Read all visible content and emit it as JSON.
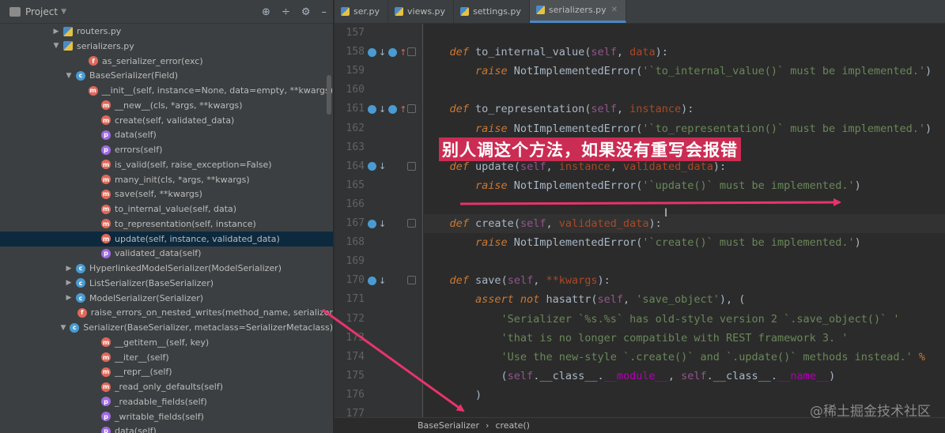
{
  "project": {
    "title": "Project",
    "tools": [
      "⊕",
      "÷",
      "⚙",
      "–"
    ],
    "tree": [
      {
        "indent": 80,
        "arrow": "▶",
        "icon": "py",
        "icon_name": "python-file-icon",
        "label": "routers.py",
        "selected": false
      },
      {
        "indent": 80,
        "arrow": "▼",
        "icon": "py",
        "icon_name": "python-file-icon",
        "label": "serializers.py",
        "selected": false
      },
      {
        "indent": 112,
        "arrow": "",
        "icon": "f",
        "icon_name": "function-icon",
        "label": "as_serializer_error(exc)",
        "selected": false
      },
      {
        "indent": 96,
        "arrow": "▼",
        "icon": "c",
        "icon_name": "class-icon",
        "label": "BaseSerializer(Field)",
        "selected": false
      },
      {
        "indent": 128,
        "arrow": "",
        "icon": "m",
        "icon_name": "method-icon",
        "label": "__init__(self, instance=None, data=empty, **kwargs)",
        "selected": false
      },
      {
        "indent": 128,
        "arrow": "",
        "icon": "m",
        "icon_name": "method-icon",
        "label": "__new__(cls, *args, **kwargs)",
        "selected": false
      },
      {
        "indent": 128,
        "arrow": "",
        "icon": "m",
        "icon_name": "method-icon",
        "label": "create(self, validated_data)",
        "selected": false
      },
      {
        "indent": 128,
        "arrow": "",
        "icon": "p",
        "icon_name": "property-icon",
        "label": "data(self)",
        "selected": false
      },
      {
        "indent": 128,
        "arrow": "",
        "icon": "p",
        "icon_name": "property-icon",
        "label": "errors(self)",
        "selected": false
      },
      {
        "indent": 128,
        "arrow": "",
        "icon": "m",
        "icon_name": "method-icon",
        "label": "is_valid(self, raise_exception=False)",
        "selected": false
      },
      {
        "indent": 128,
        "arrow": "",
        "icon": "m",
        "icon_name": "method-icon",
        "label": "many_init(cls, *args, **kwargs)",
        "selected": false
      },
      {
        "indent": 128,
        "arrow": "",
        "icon": "m",
        "icon_name": "method-icon",
        "label": "save(self, **kwargs)",
        "selected": false
      },
      {
        "indent": 128,
        "arrow": "",
        "icon": "m",
        "icon_name": "method-icon",
        "label": "to_internal_value(self, data)",
        "selected": false
      },
      {
        "indent": 128,
        "arrow": "",
        "icon": "m",
        "icon_name": "method-icon",
        "label": "to_representation(self, instance)",
        "selected": false
      },
      {
        "indent": 128,
        "arrow": "",
        "icon": "m",
        "icon_name": "method-icon",
        "label": "update(self, instance, validated_data)",
        "selected": true
      },
      {
        "indent": 128,
        "arrow": "",
        "icon": "p",
        "icon_name": "property-icon",
        "label": "validated_data(self)",
        "selected": false
      },
      {
        "indent": 96,
        "arrow": "▶",
        "icon": "c",
        "icon_name": "class-icon",
        "label": "HyperlinkedModelSerializer(ModelSerializer)",
        "selected": false
      },
      {
        "indent": 96,
        "arrow": "▶",
        "icon": "c",
        "icon_name": "class-icon",
        "label": "ListSerializer(BaseSerializer)",
        "selected": false
      },
      {
        "indent": 96,
        "arrow": "▶",
        "icon": "c",
        "icon_name": "class-icon",
        "label": "ModelSerializer(Serializer)",
        "selected": false
      },
      {
        "indent": 112,
        "arrow": "",
        "icon": "f",
        "icon_name": "function-icon",
        "label": "raise_errors_on_nested_writes(method_name, serializer",
        "selected": false
      },
      {
        "indent": 96,
        "arrow": "▼",
        "icon": "c",
        "icon_name": "class-icon",
        "label": "Serializer(BaseSerializer, metaclass=SerializerMetaclass)",
        "selected": false
      },
      {
        "indent": 128,
        "arrow": "",
        "icon": "m",
        "icon_name": "method-icon",
        "label": "__getitem__(self, key)",
        "selected": false
      },
      {
        "indent": 128,
        "arrow": "",
        "icon": "m",
        "icon_name": "method-icon",
        "label": "__iter__(self)",
        "selected": false
      },
      {
        "indent": 128,
        "arrow": "",
        "icon": "m",
        "icon_name": "method-icon",
        "label": "__repr__(self)",
        "selected": false
      },
      {
        "indent": 128,
        "arrow": "",
        "icon": "m",
        "icon_name": "method-icon",
        "label": "_read_only_defaults(self)",
        "selected": false
      },
      {
        "indent": 128,
        "arrow": "",
        "icon": "p",
        "icon_name": "property-icon",
        "label": "_readable_fields(self)",
        "selected": false
      },
      {
        "indent": 128,
        "arrow": "",
        "icon": "p",
        "icon_name": "property-icon",
        "label": "_writable_fields(self)",
        "selected": false
      },
      {
        "indent": 128,
        "arrow": "",
        "icon": "p",
        "icon_name": "property-icon",
        "label": "data(self)",
        "selected": false
      }
    ]
  },
  "tabs": [
    {
      "label": "ser.py",
      "active": false
    },
    {
      "label": "views.py",
      "active": false
    },
    {
      "label": "settings.py",
      "active": false
    },
    {
      "label": "serializers.py",
      "active": true
    }
  ],
  "code_lines": [
    {
      "num": "157",
      "icons": "",
      "html": ""
    },
    {
      "num": "158",
      "icons": "updown",
      "html": "    <span class=\"kw\">def</span> <span class=\"fnplain\">to_internal_value</span>(<span class=\"self\">self</span>, <span class=\"param\">data</span>):"
    },
    {
      "num": "159",
      "icons": "",
      "html": "        <span class=\"kw\">raise</span> NotImplementedError(<span class=\"str\">'`to_internal_value()` must be implemented.'</span>)"
    },
    {
      "num": "160",
      "icons": "",
      "html": ""
    },
    {
      "num": "161",
      "icons": "updown",
      "html": "    <span class=\"kw\">def</span> <span class=\"fnplain\">to_representation</span>(<span class=\"self\">self</span>, <span class=\"param\">instance</span>):"
    },
    {
      "num": "162",
      "icons": "",
      "html": "        <span class=\"kw\">raise</span> NotImplementedError(<span class=\"str\">'`to_representation()` must be implemented.'</span>)"
    },
    {
      "num": "163",
      "icons": "",
      "html": ""
    },
    {
      "num": "164",
      "icons": "down",
      "html": "    <span class=\"kw\">def</span> <span class=\"fnplain\">update</span>(<span class=\"self\">self</span>, <span class=\"param\">instance</span>, <span class=\"param\">validated_data</span>):"
    },
    {
      "num": "165",
      "icons": "",
      "html": "        <span class=\"kw\">raise</span> NotImplementedError(<span class=\"str\">'`update()` must be implemented.'</span>)"
    },
    {
      "num": "166",
      "icons": "",
      "html": ""
    },
    {
      "num": "167",
      "icons": "down",
      "html": "    <span class=\"kw\">def</span> <span class=\"fnplain\">create</span>(<span class=\"self\">self</span>, <span class=\"param\">validated_data</span>):",
      "current": true
    },
    {
      "num": "168",
      "icons": "",
      "html": "        <span class=\"kw\">raise</span> NotImplementedError(<span class=\"str\">'`create()` must be implemented.'</span>)"
    },
    {
      "num": "169",
      "icons": "",
      "html": ""
    },
    {
      "num": "170",
      "icons": "down",
      "html": "    <span class=\"kw\">def</span> <span class=\"fnplain\">save</span>(<span class=\"self\">self</span>, <span class=\"param\">**kwargs</span>):"
    },
    {
      "num": "171",
      "icons": "",
      "html": "        <span class=\"kw\">assert not</span> hasattr(<span class=\"self\">self</span>, <span class=\"str\">'save_object'</span>), ("
    },
    {
      "num": "172",
      "icons": "",
      "html": "            <span class=\"str\">'Serializer `%s.%s` has old-style version 2 `.save_object()` '</span>"
    },
    {
      "num": "173",
      "icons": "",
      "html": "            <span class=\"str\">'that is no longer compatible with REST framework 3. '</span>"
    },
    {
      "num": "174",
      "icons": "",
      "html": "            <span class=\"str\">'Use the new-style `.create()` and `.update()` methods instead.'</span> <span class=\"pct\">%</span>"
    },
    {
      "num": "175",
      "icons": "",
      "html": "            (<span class=\"self\">self</span>.__class__.<span class=\"dunder\">__module__</span>, <span class=\"self\">self</span>.__class__.<span class=\"dunder\">__name__</span>)"
    },
    {
      "num": "176",
      "icons": "",
      "html": "        )"
    },
    {
      "num": "177",
      "icons": "",
      "html": ""
    }
  ],
  "annotation": "别人调这个方法，如果没有重写会报错",
  "watermark": "@稀土掘金技术社区",
  "breadcrumbs": [
    "BaseSerializer",
    "›",
    "create()"
  ],
  "colors": {
    "annotation_arrow": "#e8336b",
    "selection": "#0d293e",
    "accent_tab": "#4a88c7"
  }
}
